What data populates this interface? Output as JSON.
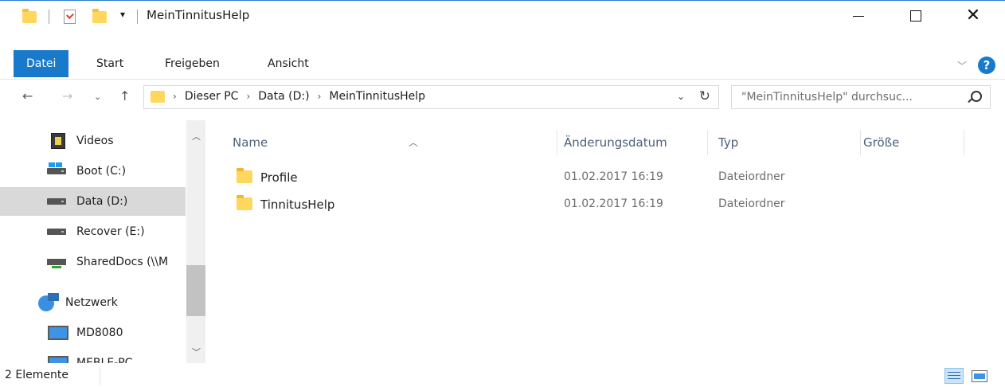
{
  "window": {
    "title": "MeinTinnitusHelp",
    "qat_dropdown": "▾"
  },
  "ribbon": {
    "tabs": [
      "Datei",
      "Start",
      "Freigeben",
      "Ansicht"
    ],
    "help_label": "?"
  },
  "address": {
    "crumbs": [
      "Dieser PC",
      "Data (D:)",
      "MeinTinnitusHelp"
    ]
  },
  "search": {
    "placeholder": "\"MeinTinnitusHelp\" durchsuc..."
  },
  "navpane": {
    "items": [
      {
        "label": "Videos",
        "icon": "video-icon",
        "selected": false
      },
      {
        "label": "Boot (C:)",
        "icon": "windows-drive-icon",
        "selected": false
      },
      {
        "label": "Data (D:)",
        "icon": "drive-icon",
        "selected": true
      },
      {
        "label": "Recover (E:)",
        "icon": "drive-icon",
        "selected": false
      },
      {
        "label": "SharedDocs (\\\\M",
        "icon": "network-drive-icon",
        "selected": false
      },
      {
        "label": "Netzwerk",
        "icon": "network-icon",
        "selected": false
      },
      {
        "label": "MD8080",
        "icon": "computer-icon",
        "selected": false
      },
      {
        "label": "MEBLE-PC",
        "icon": "computer-icon",
        "selected": false
      }
    ]
  },
  "filelist": {
    "columns": [
      "Name",
      "Änderungsdatum",
      "Typ",
      "Größe"
    ],
    "rows": [
      {
        "name": "Profile",
        "date": "01.02.2017 16:19",
        "type": "Dateiordner",
        "size": ""
      },
      {
        "name": "TinnitusHelp",
        "date": "01.02.2017 16:19",
        "type": "Dateiordner",
        "size": ""
      }
    ]
  },
  "status": {
    "count": "2 Elemente"
  },
  "colors": {
    "accent": "#1979ca",
    "selection": "#d9d9d9",
    "folder": "#ffd75e"
  }
}
